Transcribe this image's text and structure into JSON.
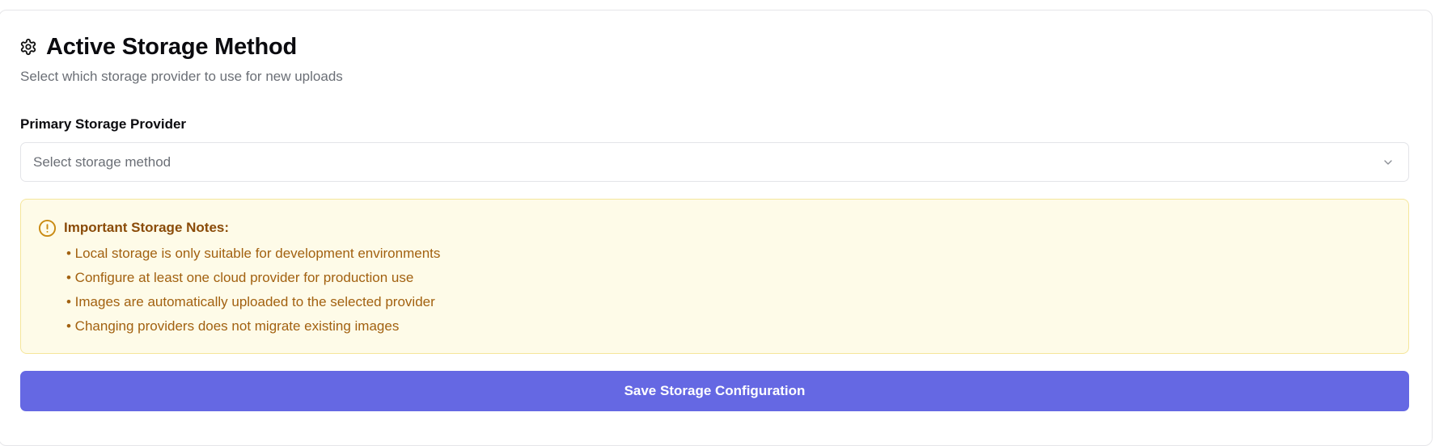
{
  "section": {
    "title": "Active Storage Method",
    "subtitle": "Select which storage provider to use for new uploads",
    "title_icon": "gear-icon"
  },
  "form": {
    "provider_label": "Primary Storage Provider",
    "provider_placeholder": "Select storage method",
    "provider_value": ""
  },
  "notice": {
    "title": "Important Storage Notes:",
    "icon": "alert-circle-icon",
    "items": [
      "• Local storage is only suitable for development environments",
      "• Configure at least one cloud provider for production use",
      "• Images are automatically uploaded to the selected provider",
      "• Changing providers does not migrate existing images"
    ]
  },
  "actions": {
    "save_label": "Save Storage Configuration"
  },
  "colors": {
    "accent": "#6568e3",
    "notice_background": "#fefbe8",
    "notice_border": "#f5e69a",
    "notice_text": "#a26110",
    "notice_title": "#8a4b08"
  }
}
